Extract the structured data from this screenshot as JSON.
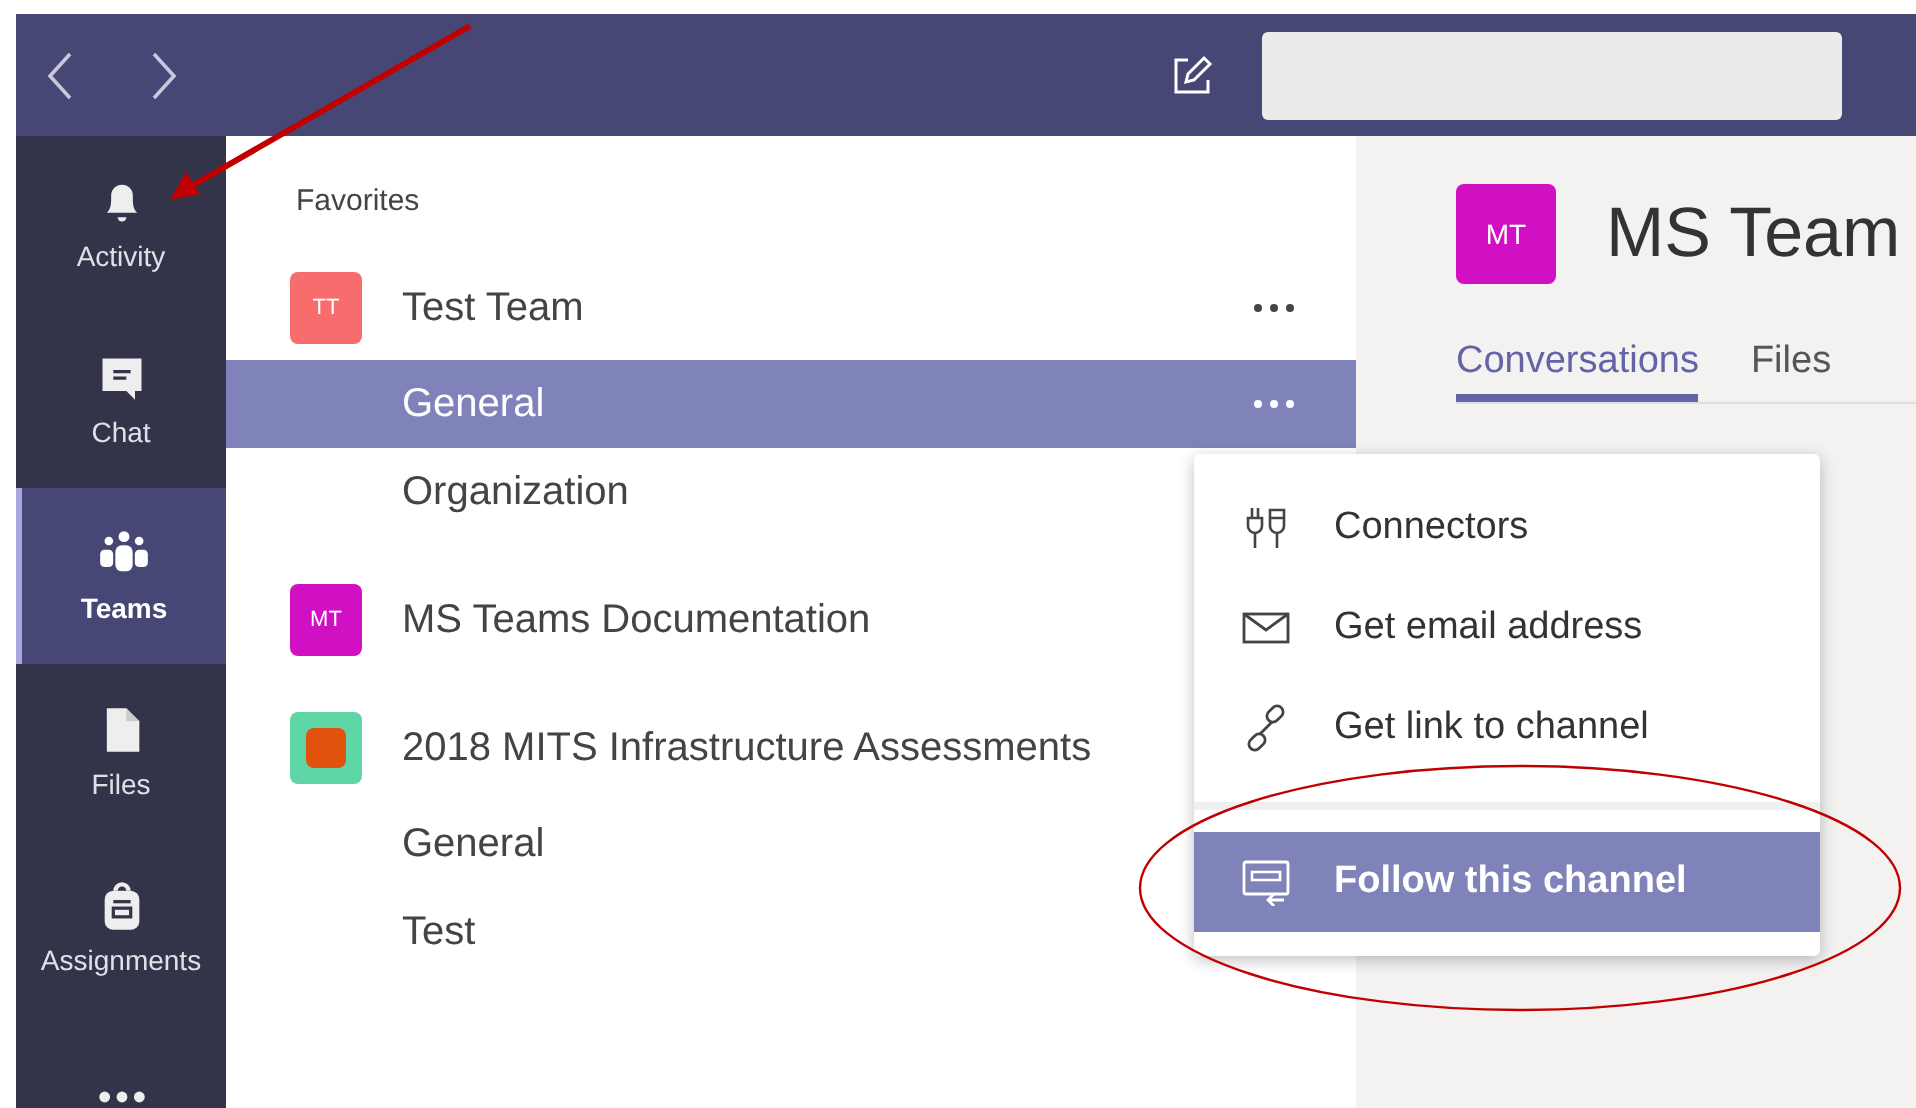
{
  "rail": {
    "items": [
      {
        "label": "Activity",
        "selected": false
      },
      {
        "label": "Chat",
        "selected": false
      },
      {
        "label": "Teams",
        "selected": true
      },
      {
        "label": "Files",
        "selected": false
      },
      {
        "label": "Assignments",
        "selected": false
      }
    ]
  },
  "teams_list": {
    "section": "Favorites",
    "teams": [
      {
        "name": "Test Team",
        "avatar": {
          "kind": "initials",
          "initials": "TT"
        },
        "color": "#f76c6c",
        "more": true,
        "channels": [
          {
            "name": "General",
            "selected": true,
            "more": true
          },
          {
            "name": "Organization",
            "selected": false,
            "more": false
          }
        ]
      },
      {
        "name": "MS Teams Documentation",
        "avatar": {
          "kind": "initials",
          "initials": "MT"
        },
        "color": "#d10fc3",
        "more": false
      },
      {
        "name": "2018 MITS Infrastructure Assessments",
        "avatar": {
          "kind": "image"
        },
        "color": "#5fd6a6",
        "more": false,
        "channels": [
          {
            "name": "General",
            "selected": false,
            "more": false
          },
          {
            "name": "Test",
            "selected": false,
            "more": false
          }
        ]
      }
    ]
  },
  "header": {
    "avatar": "MT",
    "color": "#d10fc3",
    "title": "MS Team",
    "tabs": [
      {
        "label": "Conversations",
        "selected": true
      },
      {
        "label": "Files",
        "selected": false
      }
    ]
  },
  "menu": {
    "items": [
      {
        "label": "Connectors",
        "selected": false,
        "divider_before": false
      },
      {
        "label": "Get email address",
        "selected": false,
        "divider_before": false
      },
      {
        "label": "Get link to channel",
        "selected": false,
        "divider_before": false
      },
      {
        "label": "Follow this channel",
        "selected": true,
        "divider_before": true
      }
    ]
  }
}
